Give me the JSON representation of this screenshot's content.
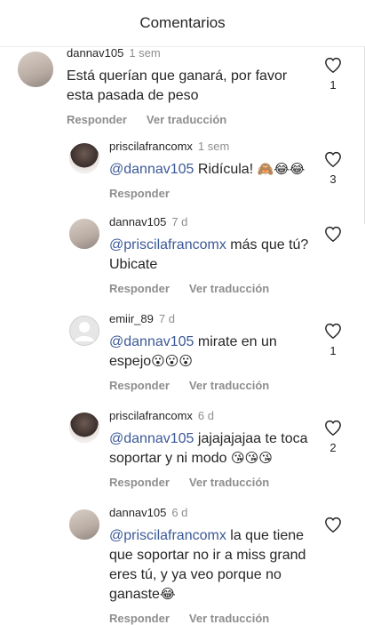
{
  "header": {
    "title": "Comentarios"
  },
  "actions": {
    "reply": "Responder",
    "translate": "Ver traducción"
  },
  "comments": [
    {
      "user": "dannav105",
      "time": "1 sem",
      "text": "Está querían que ganará, por favor esta pasada de peso",
      "likes": "1"
    },
    {
      "user": "priscilafrancomx",
      "time": "1 sem",
      "mention": "@dannav105",
      "text": " Ridícula! ",
      "emojis": "🙈😂😂",
      "likes": "3"
    },
    {
      "user": "dannav105",
      "time": "7 d",
      "mention": "@priscilafrancomx",
      "text": " más que tú? Ubicate",
      "likes": ""
    },
    {
      "user": "emiir_89",
      "time": "7 d",
      "mention": "@dannav105",
      "text": " mirate en un espejo",
      "emojis": "😮😮😮",
      "likes": "1"
    },
    {
      "user": "priscilafrancomx",
      "time": "6 d",
      "mention": "@dannav105",
      "text": " jajajajajaa te toca soportar y ni modo ",
      "emojis": "😘😘😘",
      "likes": "2"
    },
    {
      "user": "dannav105",
      "time": "6 d",
      "mention": "@priscilafrancomx",
      "text": " la que tiene que soportar no ir a miss grand eres tú, y ya veo porque no ganaste",
      "emojis": "😂",
      "likes": ""
    }
  ]
}
